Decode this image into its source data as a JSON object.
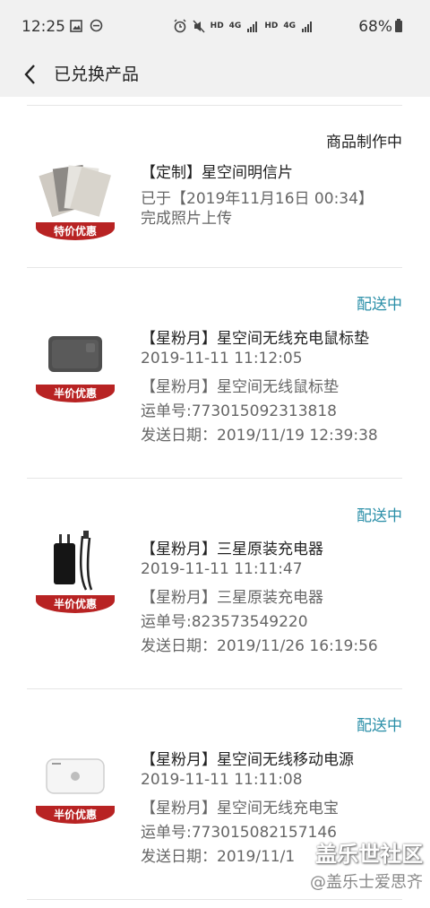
{
  "status_bar": {
    "time": "12:25",
    "battery": "68%",
    "network_labels": [
      "HD",
      "4G",
      "HD",
      "4G"
    ]
  },
  "header": {
    "title": "已兑换产品"
  },
  "orders": [
    {
      "status": "商品制作中",
      "badge": "特价优惠",
      "title": "【定制】星空间明信片",
      "line1": "已于【2019年11月16日 00:34】",
      "line2": "完成照片上传"
    },
    {
      "status": "配送中",
      "badge": "半价优惠",
      "title": "【星粉月】星空间无线充电鼠标垫",
      "line1": "2019-11-11 11:12:05",
      "line2": "【星粉月】星空间无线鼠标垫",
      "line3": "运单号:773015092313818",
      "line4": "发送日期：2019/11/19 12:39:38"
    },
    {
      "status": "配送中",
      "badge": "半价优惠",
      "title": "【星粉月】三星原装充电器",
      "line1": "2019-11-11 11:11:47",
      "line2": "【星粉月】三星原装充电器",
      "line3": "运单号:823573549220",
      "line4": "发送日期：2019/11/26 16:19:56"
    },
    {
      "status": "配送中",
      "badge": "半价优惠",
      "title": "【星粉月】星空间无线移动电源",
      "line1": "2019-11-11 11:11:08",
      "line2": "【星粉月】星空间无线充电宝",
      "line3": "运单号:773015082157146",
      "line4": "发送日期：2019/11/1"
    }
  ],
  "watermark": {
    "line1": "盖乐世社区",
    "line2": "@盖乐士爱思齐"
  },
  "colors": {
    "shipping": "#2b8fa8",
    "badge": "#b82323",
    "header_bg": "#f1f1f1"
  }
}
